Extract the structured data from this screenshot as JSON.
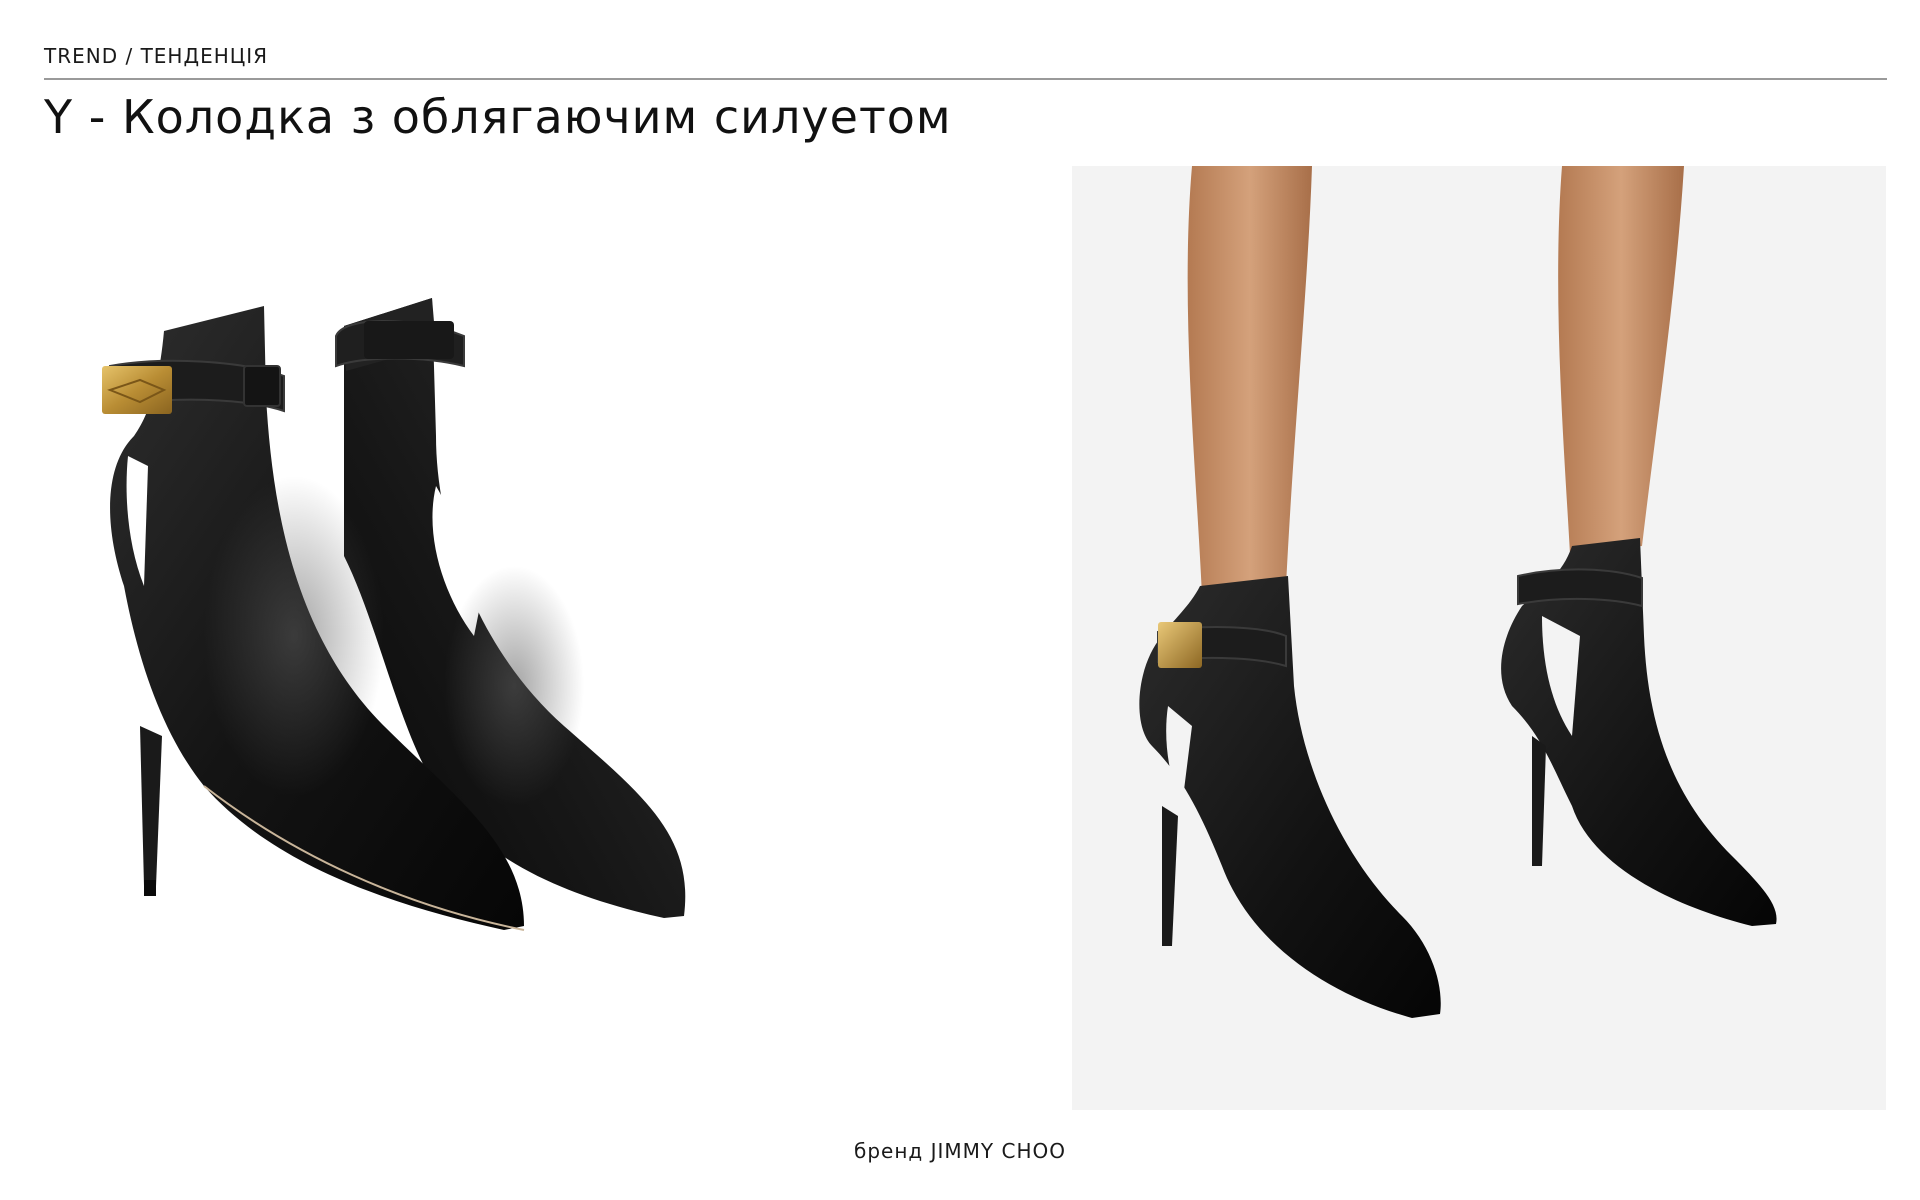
{
  "header": {
    "kicker": "TREND / ТЕНДЕНЦІЯ",
    "title": "Y - Колодка з облягаючим силуетом"
  },
  "footer": {
    "caption": "бренд JIMMY CHOO"
  },
  "colors": {
    "rule": "#9a9a9a",
    "leather": "#1b1b1b",
    "gold_hardware": "#c9a046",
    "skin": "#c8926a",
    "photo_background": "#f3f3f3"
  },
  "images": {
    "left": "product-photo-black-cutout-ankle-boots-pair",
    "right": "model-photo-legs-wearing-black-ankle-boots"
  }
}
